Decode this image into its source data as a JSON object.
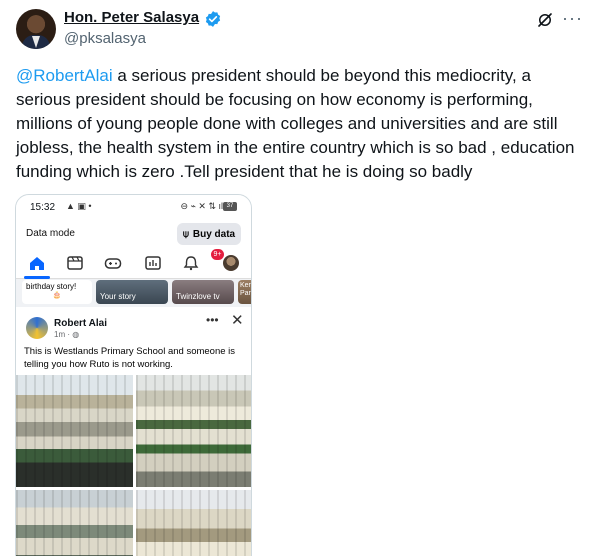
{
  "tweet": {
    "author_name": "Hon. Peter Salasya",
    "handle": "@pksalasya",
    "mention": "@RobertAlai",
    "text": " a serious president should be beyond this mediocrity, a serious president should be focusing on how economy is performing, millions of young people done with colleges and universities and are still jobless, the health system in the entire country which is so bad , education funding which is zero .Tell president that he is doing so badly",
    "colors": {
      "link": "#1d9bf0",
      "verified": "#1d9bf0",
      "muted": "#536471"
    }
  },
  "embedded_screenshot": {
    "status_bar": {
      "time": "15:32",
      "battery": "37"
    },
    "data_mode": {
      "label": "Data mode",
      "button": "Buy data"
    },
    "nav": {
      "notification_badge": "9+"
    },
    "stories": [
      {
        "label": "birthday story!",
        "emoji": "🎂"
      },
      {
        "label": "Your story"
      },
      {
        "label": "Twinzlove tv"
      },
      {
        "label": "Ker Pan"
      }
    ],
    "post": {
      "author": "Robert Alai",
      "time": "1m · ",
      "text": "This is Westlands Primary School and someone is telling you how Ruto is not working."
    }
  }
}
